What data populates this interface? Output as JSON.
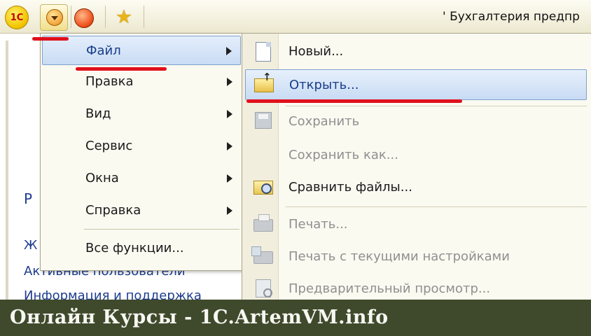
{
  "toolbar": {
    "logo_text": "1С",
    "window_title": "' Бухгалтерия предпр"
  },
  "background": {
    "heading": "Р",
    "links": [
      "Ж",
      "Активные пользователи",
      "Информация и поддержка"
    ]
  },
  "main_menu": {
    "items": [
      {
        "label": "Файл",
        "has_submenu": true,
        "active": true
      },
      {
        "label": "Правка",
        "has_submenu": true
      },
      {
        "label": "Вид",
        "has_submenu": true
      },
      {
        "label": "Сервис",
        "has_submenu": true
      },
      {
        "label": "Окна",
        "has_submenu": true
      },
      {
        "label": "Справка",
        "has_submenu": true
      },
      {
        "label": "Все функции...",
        "has_submenu": false
      }
    ]
  },
  "file_menu": {
    "items": [
      {
        "label": "Новый...",
        "icon": "new-document-icon",
        "enabled": true
      },
      {
        "label": "Открыть...",
        "icon": "open-folder-icon",
        "enabled": true,
        "active": true
      },
      {
        "label": "Сохранить",
        "icon": "save-disk-icon",
        "enabled": false
      },
      {
        "label": "Сохранить как...",
        "icon": "",
        "enabled": false
      },
      {
        "label": "Сравнить файлы...",
        "icon": "compare-files-icon",
        "enabled": true
      },
      {
        "label": "Печать...",
        "icon": "printer-icon",
        "enabled": false
      },
      {
        "label": "Печать с текущими настройками",
        "icon": "printer-settings-icon",
        "enabled": false
      },
      {
        "label": "Предварительный просмотр...",
        "icon": "print-preview-icon",
        "enabled": false
      }
    ]
  },
  "banner": {
    "text": "Онлайн Курсы - 1C.ArtemVM.info"
  },
  "colors": {
    "annotation_red": "#e0101b",
    "highlight_blue": "#c9dcf5",
    "banner_bg": "#3f4a2c"
  }
}
